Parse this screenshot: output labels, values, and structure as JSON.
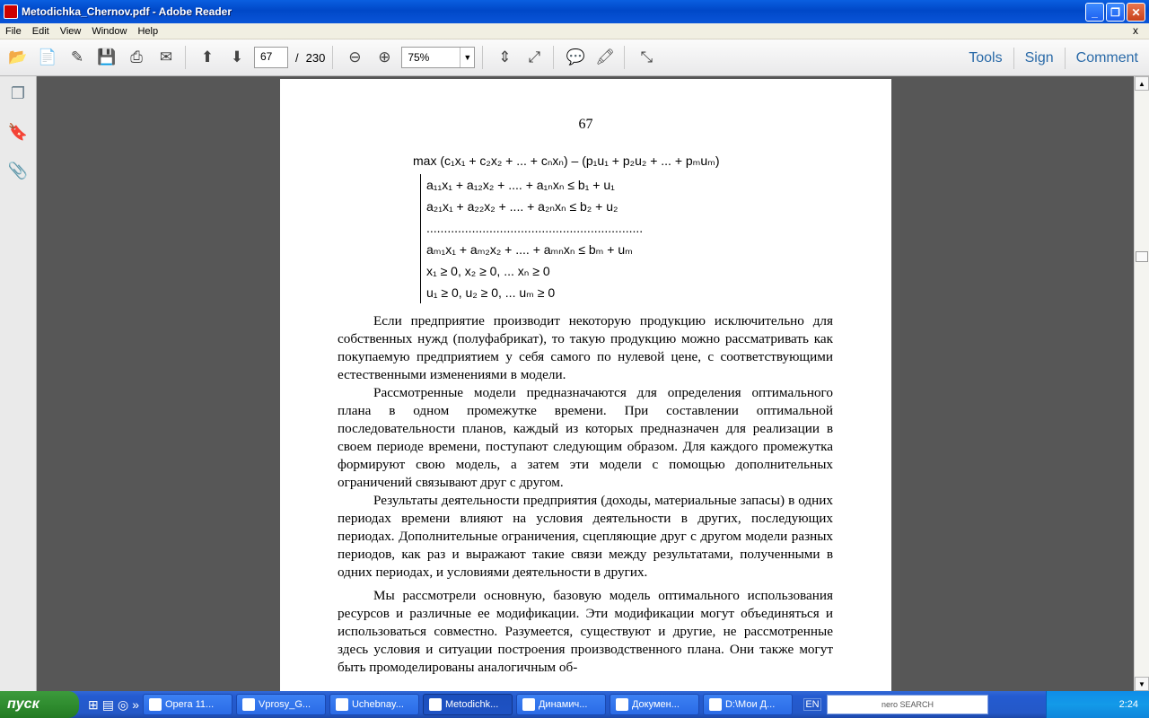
{
  "window": {
    "title": "Metodichka_Chernov.pdf - Adobe Reader",
    "min": "_",
    "max": "❐",
    "close": "✕"
  },
  "menu": {
    "items": [
      "File",
      "Edit",
      "View",
      "Window",
      "Help"
    ],
    "close": "x"
  },
  "toolbar": {
    "page_current": "67",
    "page_sep": "/",
    "page_total": "230",
    "zoom": "75%",
    "tools": "Tools",
    "sign": "Sign",
    "comment": "Comment"
  },
  "document": {
    "page_number": "67",
    "formula_max": "max   (c₁x₁ + c₂x₂ + ... + cₙxₙ) – (p₁u₁ + p₂u₂ + ... + pₘuₘ)",
    "system": [
      "a₁₁x₁ + a₁₂x₂ + .... + a₁ₙxₙ ≤ b₁ + u₁",
      "a₂₁x₁ + a₂₂x₂ + .... + a₂ₙxₙ ≤ b₂ + u₂",
      "..............................................................",
      "aₘ₁x₁ + aₘ₂x₂ + .... + aₘₙxₙ ≤ bₘ + uₘ",
      "x₁ ≥ 0,  x₂ ≥ 0,   ...   xₙ ≥ 0",
      "u₁ ≥ 0, u₂ ≥ 0,  ...  uₘ ≥ 0"
    ],
    "paragraphs": [
      "Если предприятие производит некоторую продукцию исключительно для собственных нужд (полуфабрикат), то такую продукцию можно рассматривать как покупаемую предприятием у себя самого по нулевой цене, с соответствующими естественными изменениями в модели.",
      "Рассмотренные модели предназначаются для определения оптимального плана в одном промежутке времени. При составлении оптимальной последовательности планов, каждый из которых предназначен для реализации в своем периоде времени, поступают следующим образом. Для каждого промежутка формируют свою модель, а затем эти модели с помощью дополнительных ограничений связывают друг с другом.",
      "Результаты деятельности предприятия (доходы, материальные запасы) в одних периодах времени влияют на условия деятельности в других, последующих периодах. Дополнительные ограничения, сцепляющие друг с другом модели разных периодов, как раз и выражают такие связи между результатами, полученными в одних периодах, и условиями деятельности в других.",
      "Мы рассмотрели основную, базовую модель оптимального использования ресурсов и различные ее модификации. Эти модификации могут объединяться и использоваться совместно. Разумеется, существуют и другие, не рассмотренные здесь условия и ситуации построения производственного плана. Они также могут быть промоделированы аналогичным об-"
    ]
  },
  "taskbar": {
    "start": "пуск",
    "tasks": [
      "Opera 11...",
      "Vprosy_G...",
      "Uchebnay...",
      "Metodichk...",
      "Динамич...",
      "Докумен...",
      "D:\\Мои Д..."
    ],
    "lang": "EN",
    "search_placeholder": "nero SEARCH",
    "clock": "2:24"
  }
}
